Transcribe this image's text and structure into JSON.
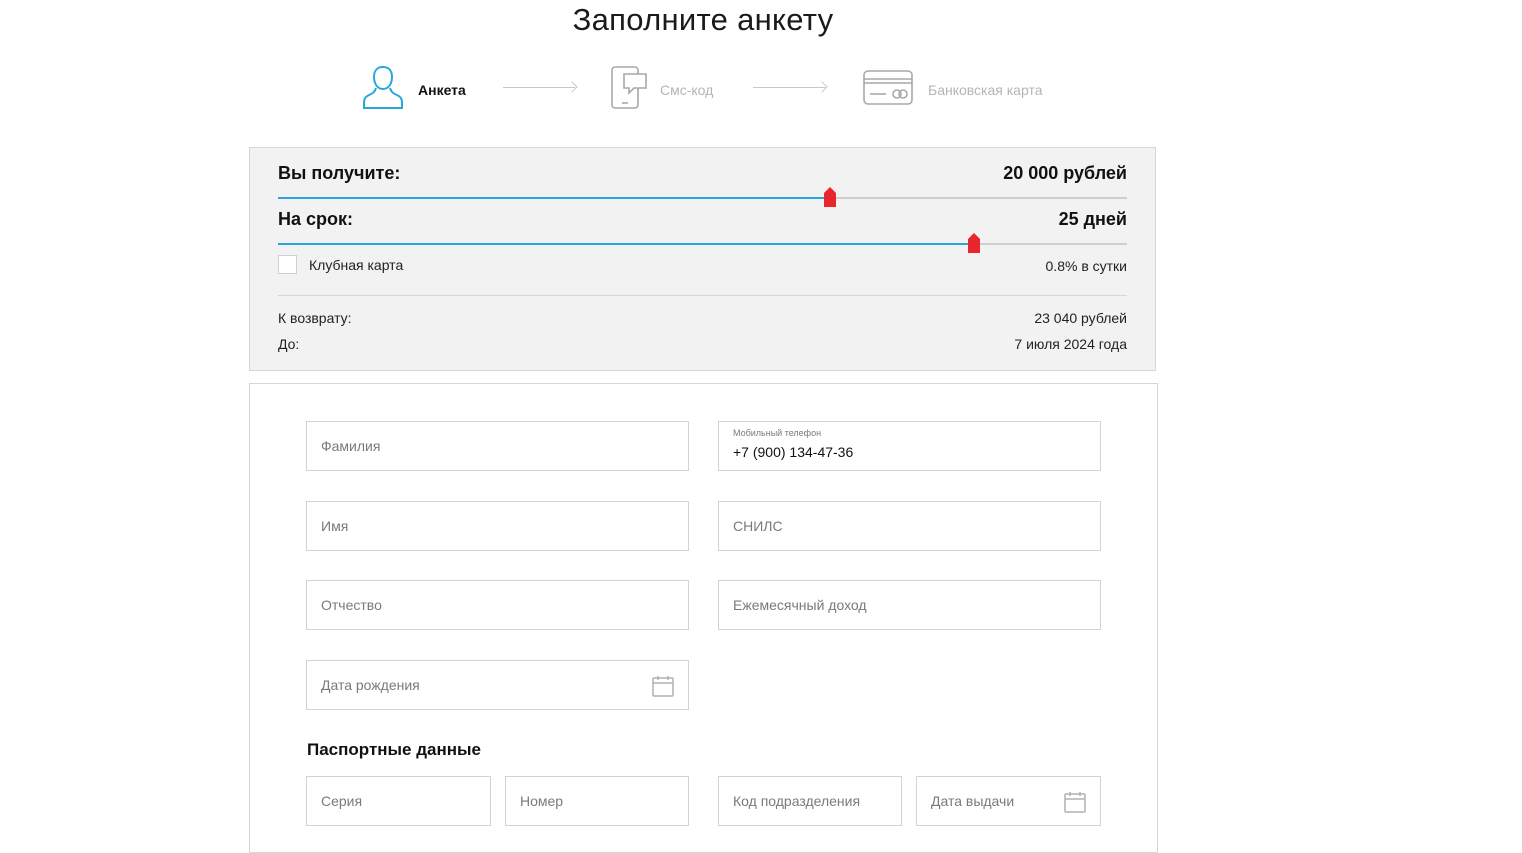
{
  "page_title": "Заполните анкету",
  "steps": [
    {
      "label": "Анкета",
      "icon": "user-icon",
      "state": "active"
    },
    {
      "label": "Смс-код",
      "icon": "phone-message-icon",
      "state": "inactive"
    },
    {
      "label": "Банковская карта",
      "icon": "bank-card-icon",
      "state": "inactive"
    }
  ],
  "calculator": {
    "amount_label": "Вы получите:",
    "amount_value": "20 000 рублей",
    "amount_slider_fraction": 0.65,
    "term_label": "На срок:",
    "term_value": "25 дней",
    "term_slider_fraction": 0.82,
    "club_card_label": "Клубная карта",
    "club_card_checked": false,
    "rate_text": "0.8% в сутки",
    "return_label": "К возврату:",
    "return_value": "23 040 рублей",
    "until_label": "До:",
    "until_value": "7 июля 2024 года"
  },
  "form": {
    "last_name_placeholder": "Фамилия",
    "phone_label": "Мобильный телефон",
    "phone_value": "+7 (900) 134-47-36",
    "first_name_placeholder": "Имя",
    "snils_placeholder": "СНИЛС",
    "middle_name_placeholder": "Отчество",
    "income_placeholder": "Ежемесячный доход",
    "birth_date_placeholder": "Дата рождения",
    "passport_title": "Паспортные данные",
    "series_placeholder": "Серия",
    "number_placeholder": "Номер",
    "division_code_placeholder": "Код подразделения",
    "issue_date_placeholder": "Дата выдачи"
  },
  "colors": {
    "accent_blue": "#2aa6dc",
    "thumb_red": "#e8262b",
    "panel_bg": "#f2f2f2"
  }
}
